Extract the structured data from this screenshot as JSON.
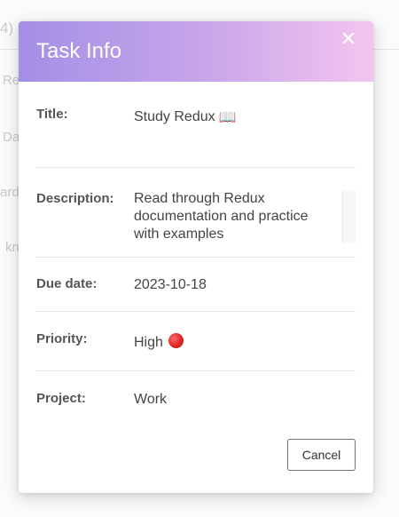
{
  "background": {
    "count_fragment": "4)",
    "row_fragments": [
      "Re",
      "Da",
      "ard",
      "kn"
    ]
  },
  "dialog": {
    "title": "Task Info",
    "close_icon": "close-icon",
    "fields": {
      "title": {
        "label": "Title:",
        "value": "Study Redux",
        "icon": "open-book-icon"
      },
      "description": {
        "label": "Description:",
        "value": "Read through Redux documentation and practice with examples"
      },
      "due_date": {
        "label": "Due date:",
        "value": "2023-10-18"
      },
      "priority": {
        "label": "Priority:",
        "value": "High",
        "icon": "red-circle-icon",
        "color": "#e02424"
      },
      "project": {
        "label": "Project:",
        "value": "Work"
      }
    },
    "cancel_label": "Cancel"
  },
  "colors": {
    "header_gradient_start": "#a38fe6",
    "header_gradient_end": "#f3c4ef"
  }
}
